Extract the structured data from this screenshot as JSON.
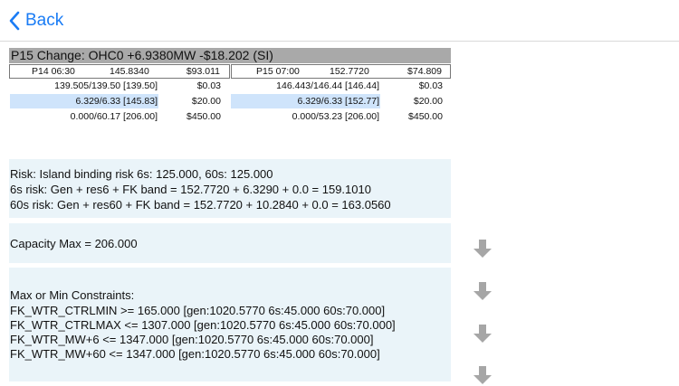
{
  "nav": {
    "back_label": "Back"
  },
  "change_header": "P15 Change: OHC0 +6.9380MW -$18.202 (SI)",
  "left": {
    "header": {
      "period": "P14 06:30",
      "mw": "145.8340",
      "price": "$93.011"
    },
    "rows": [
      {
        "value": "139.505/139.50 [139.50]",
        "price": "$0.03"
      },
      {
        "value": "6.329/6.33 [145.83]",
        "price": "$20.00"
      },
      {
        "value": "0.000/60.17 [206.00]",
        "price": "$450.00"
      }
    ]
  },
  "right": {
    "header": {
      "period": "P15 07:00",
      "mw": "152.7720",
      "price": "$74.809"
    },
    "rows": [
      {
        "value": "146.443/146.44 [146.44]",
        "price": "$0.03"
      },
      {
        "value": "6.329/6.33 [152.77]",
        "price": "$20.00"
      },
      {
        "value": "0.000/53.23 [206.00]",
        "price": "$450.00"
      }
    ]
  },
  "risk": {
    "line1": "Risk: Island binding risk 6s: 125.000,  60s: 125.000",
    "line2": "6s risk: Gen + res6 + FK band = 152.7720 + 6.3290 + 0.0 = 159.1010",
    "line3": "60s risk: Gen + res60 + FK band = 152.7720 + 10.2840 + 0.0 = 163.0560"
  },
  "capacity": "Capacity Max = 206.000",
  "constraints": {
    "title": "Max or Min Constraints:",
    "lines": [
      "FK_WTR_CTRLMIN >= 165.000 [gen:1020.5770 6s:45.000 60s:70.000]",
      "FK_WTR_CTRLMAX <= 1307.000 [gen:1020.5770 6s:45.000 60s:70.000]",
      "FK_WTR_MW+6 <= 1347.000 [gen:1020.5770 6s:45.000 60s:70.000]",
      "FK_WTR_MW+60 <= 1347.000 [gen:1020.5770 6s:45.000 60s:70.000]"
    ]
  },
  "colors": {
    "accent": "#1a7cf5",
    "highlight": "#cfe4fb",
    "card_bg": "#eaf4f9",
    "header_bg": "#a9a9a9",
    "arrow": "#a6a6a6"
  },
  "icons": {
    "back": "chevron-left-icon",
    "arrow": "arrow-down-icon"
  }
}
